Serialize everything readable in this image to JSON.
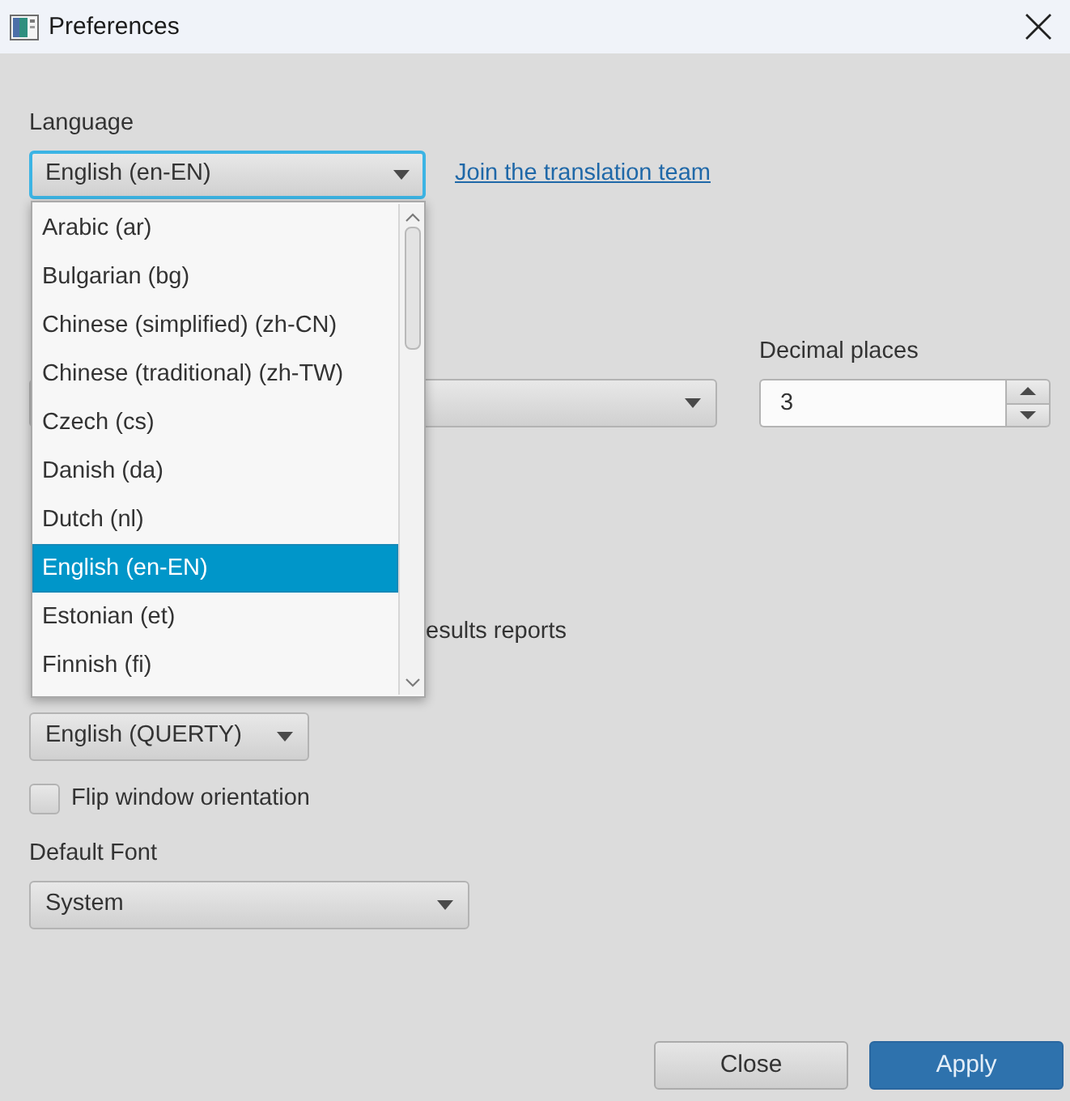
{
  "window": {
    "title": "Preferences"
  },
  "language": {
    "label": "Language",
    "value": "English (en-EN)",
    "focused": true,
    "expanded": true,
    "link": "Join the translation team",
    "options": [
      {
        "label": "Arabic (ar)",
        "selected": false
      },
      {
        "label": "Bulgarian (bg)",
        "selected": false
      },
      {
        "label": "Chinese (simplified) (zh-CN)",
        "selected": false
      },
      {
        "label": "Chinese (traditional) (zh-TW)",
        "selected": false
      },
      {
        "label": "Czech (cs)",
        "selected": false
      },
      {
        "label": "Danish (da)",
        "selected": false
      },
      {
        "label": "Dutch (nl)",
        "selected": false
      },
      {
        "label": "English (en-EN)",
        "selected": true
      },
      {
        "label": "Estonian (et)",
        "selected": false
      },
      {
        "label": "Finnish (fi)",
        "selected": false
      }
    ]
  },
  "decimal_places": {
    "label": "Decimal places",
    "value": "3"
  },
  "report_option": {
    "label": "esults reports"
  },
  "keyboard": {
    "value": "English (QUERTY)"
  },
  "flip_window": {
    "label": "Flip window orientation",
    "checked": false
  },
  "default_font": {
    "label": "Default Font",
    "value": "System"
  },
  "buttons": [
    {
      "label": "Close",
      "kind": "secondary"
    },
    {
      "label": "Apply",
      "kind": "primary"
    }
  ]
}
